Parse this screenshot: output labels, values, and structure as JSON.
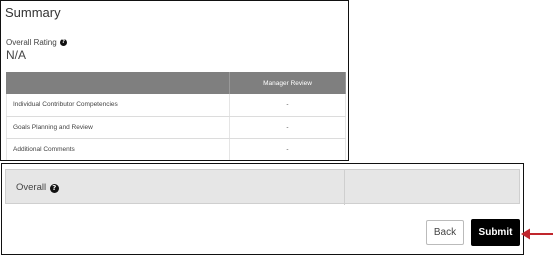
{
  "summary": {
    "title": "Summary",
    "rating_label": "Overall Rating",
    "rating_value": "N/A",
    "help_glyph": "?",
    "table": {
      "headers": [
        "",
        "Manager Review"
      ],
      "rows": [
        {
          "name": "Individual Contributor Competencies",
          "value": "-"
        },
        {
          "name": "Goals Planning and Review",
          "value": "-"
        },
        {
          "name": "Additional Comments",
          "value": "-"
        }
      ]
    }
  },
  "overall": {
    "label": "Overall",
    "help_glyph": "?"
  },
  "actions": {
    "back_label": "Back",
    "submit_label": "Submit"
  },
  "annotation": {
    "arrow_color": "#c0262d",
    "arrow_target": "submit-button"
  },
  "colors": {
    "table_header_bg": "#7f7f7f",
    "overall_row_bg": "#e6e6e6",
    "submit_bg": "#000000"
  }
}
